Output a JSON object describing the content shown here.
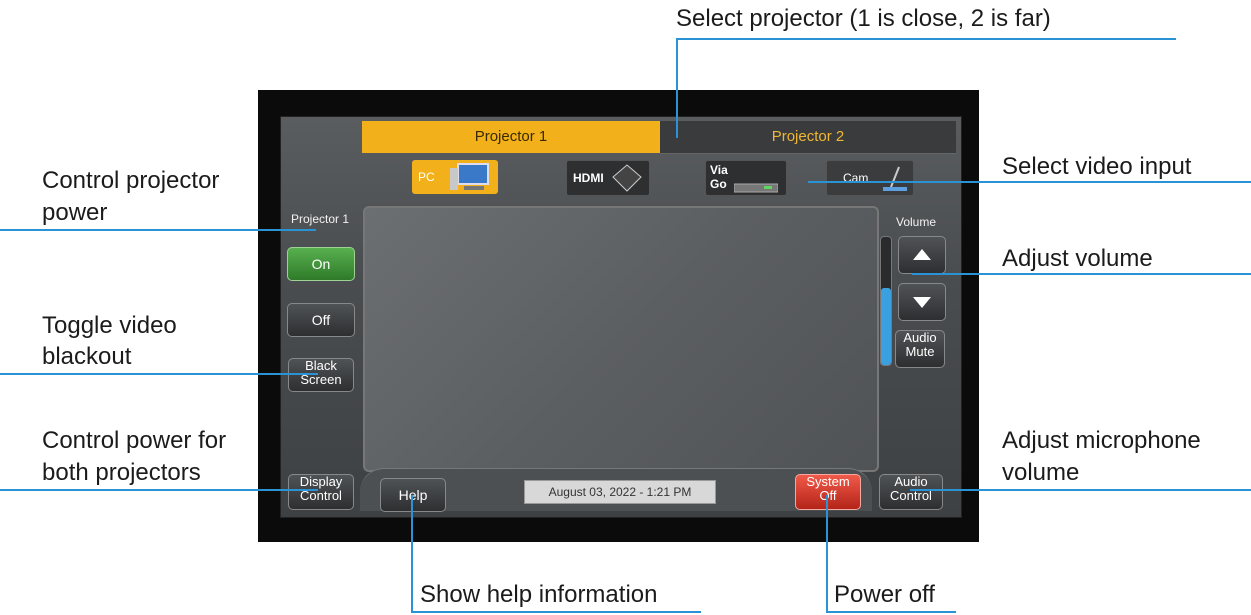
{
  "annotations": {
    "select_projector": "Select projector (1 is close, 2 is far)",
    "projector_power_l1": "Control projector",
    "projector_power_l2": "power",
    "select_video_input": "Select video input",
    "adjust_volume": "Adjust volume",
    "video_blackout_l1": "Toggle video",
    "video_blackout_l2": "blackout",
    "both_power_l1": "Control power for",
    "both_power_l2": "both projectors",
    "mic_volume_l1": "Adjust microphone",
    "mic_volume_l2": "volume",
    "help_info": "Show help information",
    "power_off": "Power off"
  },
  "panel": {
    "tabs": [
      "Projector 1",
      "Projector 2"
    ],
    "sources": {
      "pc": "PC",
      "hdmi": "HDMI",
      "via_l1": "Via",
      "via_l2": "Go",
      "cam": "Cam"
    },
    "side_title": "Projector 1",
    "on": "On",
    "off": "Off",
    "black_l1": "Black",
    "black_l2": "Screen",
    "display_l1": "Display",
    "display_l2": "Control",
    "help": "Help",
    "date": "August 03, 2022  -  1:21 PM",
    "system_l1": "System",
    "system_l2": "Off",
    "audio_ctrl_l1": "Audio",
    "audio_ctrl_l2": "Control",
    "volume_label": "Volume",
    "mute_l1": "Audio",
    "mute_l2": "Mute",
    "volume_level": 0.6
  },
  "colors": {
    "accent_line": "#2a93d5",
    "selected_tab": "#f2b11a",
    "on_green": "#3f9a36",
    "off_red": "#d33a2b"
  }
}
